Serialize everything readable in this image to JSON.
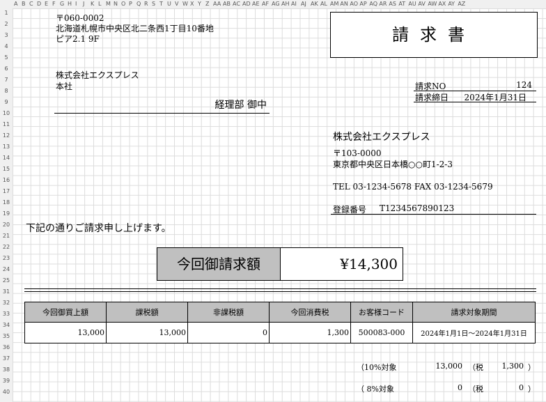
{
  "sheet": {
    "columns": [
      "A",
      "B",
      "C",
      "D",
      "E",
      "F",
      "G",
      "H",
      "I",
      "J",
      "K",
      "L",
      "M",
      "N",
      "O",
      "P",
      "Q",
      "R",
      "S",
      "T",
      "U",
      "V",
      "W",
      "X",
      "Y",
      "Z",
      "AA",
      "AB",
      "AC",
      "AD",
      "AE",
      "AF",
      "AG",
      "AH",
      "AI",
      "AJ",
      "AK",
      "AL",
      "AM",
      "AN",
      "AO",
      "AP",
      "AQ",
      "AR",
      "AS",
      "AT",
      "AU",
      "AV",
      "AW",
      "AX",
      "AY",
      "AZ"
    ],
    "rows": [
      "1",
      "2",
      "3",
      "4",
      "5",
      "6",
      "7",
      "8",
      "9",
      "10",
      "11",
      "12",
      "13",
      "14",
      "15",
      "16",
      "17",
      "18",
      "19",
      "20",
      "21",
      "22",
      "23",
      "24",
      "25",
      "31",
      "32",
      "33",
      "34",
      "35",
      "36",
      "37",
      "38",
      "39",
      "40"
    ]
  },
  "recipient": {
    "postal": "〒060-0002",
    "address1": "北海道札幌市中央区北二条西1丁目10番地",
    "address2": "ピア2.1 9F",
    "company": "株式会社エクスプレス",
    "branch": "本社",
    "department": "経理部 御中"
  },
  "invoice": {
    "title": "請求書",
    "no_label": "請求NO",
    "no_value": "124",
    "date_label": "請求締日",
    "date_value": "2024年1月31日"
  },
  "issuer": {
    "company": "株式会社エクスプレス",
    "postal": "〒103-0000",
    "address": "東京都中央区日本橋○○町1-2-3",
    "tel_fax": "TEL 03-1234-5678 FAX 03-1234-5679",
    "reg_label": "登録番号",
    "reg_value": "T1234567890123"
  },
  "message": "下記の通りご請求申し上げます。",
  "amount": {
    "label": "今回御請求額",
    "value": "¥14,300"
  },
  "summary": {
    "headers": [
      "今回御買上額",
      "課税額",
      "非課税額",
      "今回消費税",
      "お客様コード",
      "請求対象期間"
    ],
    "values": [
      "13,000",
      "13,000",
      "0",
      "1,300",
      "500083-000",
      "2024年1月1日～2024年1月31日"
    ]
  },
  "tax_breakdown": [
    {
      "label": "（10%対象",
      "amount": "13,000",
      "tax_label": "（税",
      "tax": "1,300",
      "close": "）"
    },
    {
      "label": "（ 8%対象",
      "amount": "0",
      "tax_label": "（税",
      "tax": "0",
      "close": "）"
    }
  ]
}
